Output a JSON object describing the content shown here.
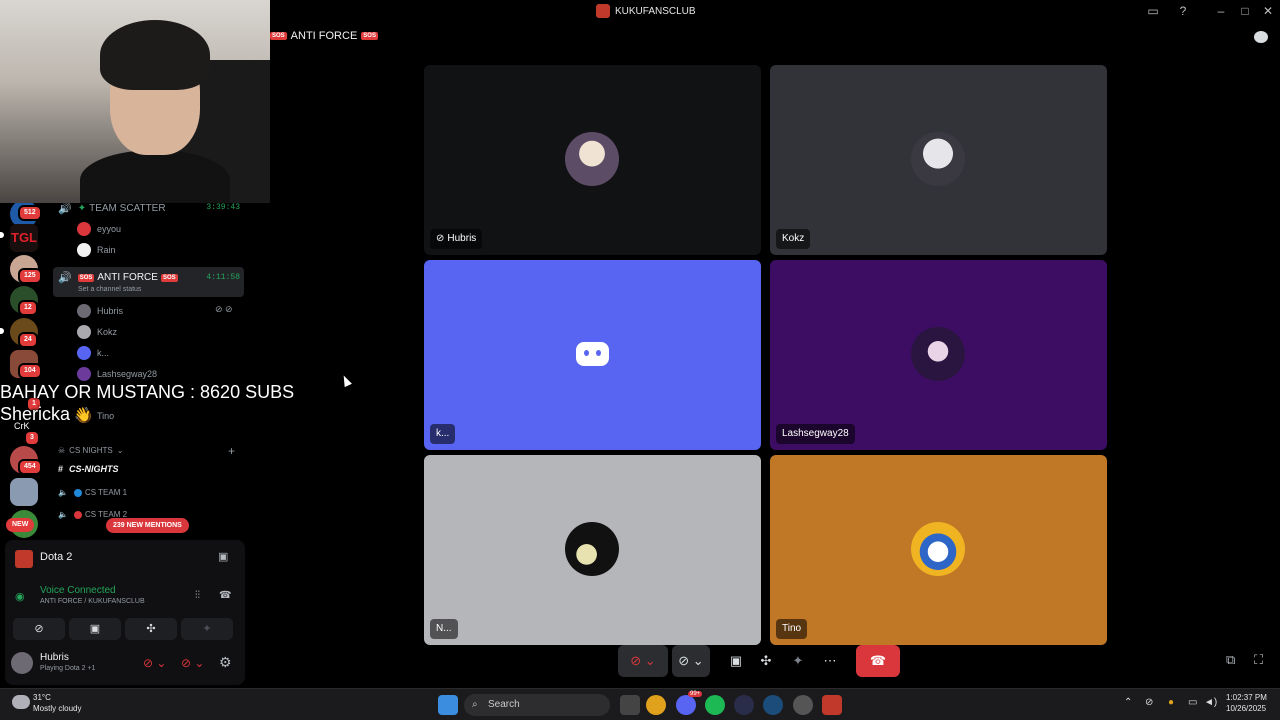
{
  "window": {
    "title": "KUKUFANSCLUB"
  },
  "header": {
    "channel_name": "ANTI FORCE",
    "channel_badge": "SOS"
  },
  "overlay": {
    "line1": "BAHAY OR MUSTANG : 8620 SUBS",
    "line2": "Shericka"
  },
  "rail": {
    "badges": [
      "512",
      "125",
      "12",
      "24",
      "104",
      "1",
      "3",
      "454"
    ],
    "new_label": "NEW",
    "crk_label": "CrK"
  },
  "sidebar": {
    "team_scatter": {
      "name": "TEAM SCATTER",
      "timer": "3:39:43",
      "members": [
        "eyyou",
        "Rain"
      ]
    },
    "anti_force": {
      "name": "ANTI FORCE",
      "timer": "4:11:58",
      "status": "Set a channel status",
      "members": [
        "Hubris",
        "Kokz",
        "k...",
        "Lashsegway28",
        "Tino"
      ]
    },
    "category": "CS NIGHTS",
    "channels": [
      "CS-NIGHTS",
      "CS TEAM 1",
      "CS TEAM 2"
    ],
    "mentions": "239 NEW MENTIONS"
  },
  "voice_panel": {
    "activity": "Dota 2",
    "status": "Voice Connected",
    "location": "ANTI FORCE / KUKUFANSCLUB",
    "user": "Hubris",
    "user_activity": "Playing Dota 2 +1"
  },
  "tiles": [
    {
      "name": "Hubris",
      "bg": "#111214",
      "muted_icon": true
    },
    {
      "name": "Kokz",
      "bg": "#313338"
    },
    {
      "name": "k...",
      "bg": "#5865f2"
    },
    {
      "name": "Lashsegway28",
      "bg": "#3c0d63"
    },
    {
      "name": "N...",
      "bg": "#b5b6ba"
    },
    {
      "name": "Tino",
      "bg": "#c07726"
    }
  ],
  "taskbar": {
    "weather_temp": "31°C",
    "weather_desc": "Mostly cloudy",
    "search_placeholder": "Search",
    "time": "1:02:37 PM",
    "date": "10/26/2025",
    "discord_badge": "99+"
  },
  "colors": {
    "discord_blurple": "#5865f2",
    "hangup_red": "#da373c",
    "online_green": "#23a55a"
  }
}
